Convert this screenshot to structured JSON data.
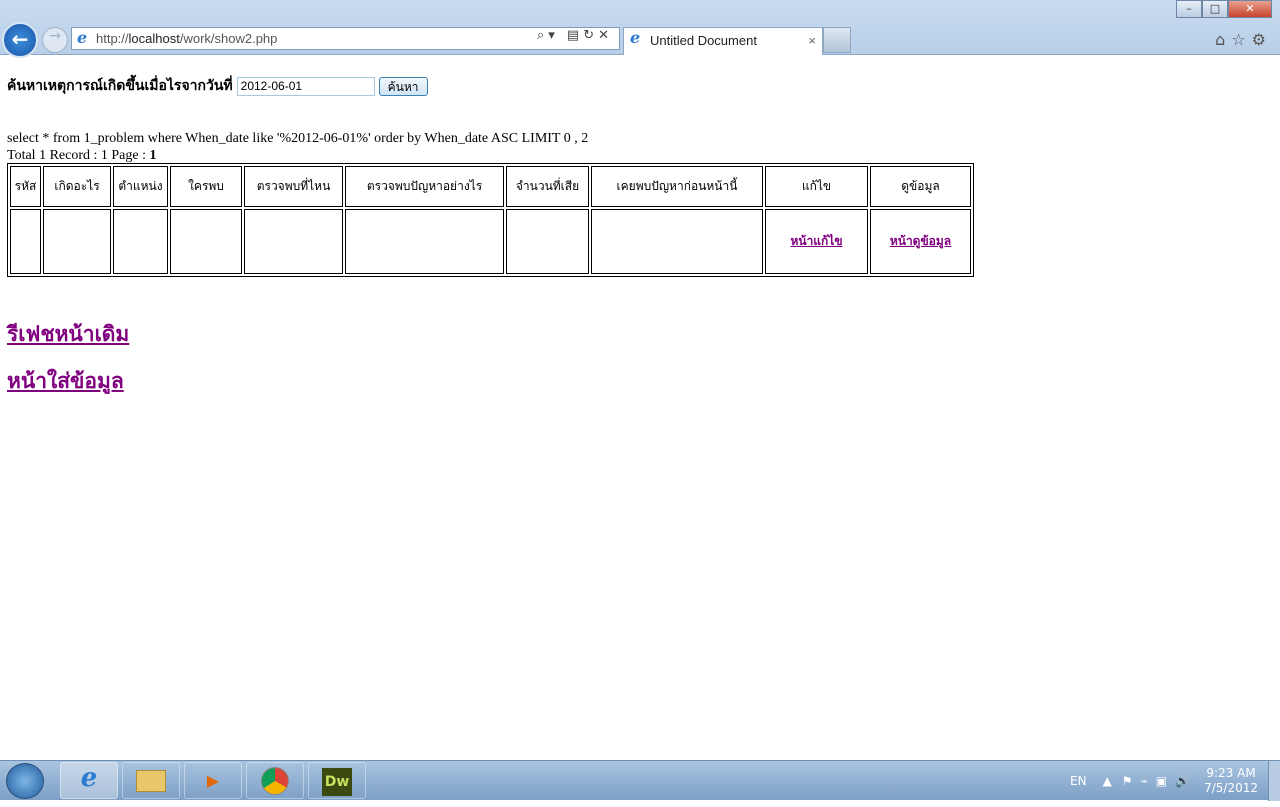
{
  "browser": {
    "url_host": "http://",
    "url_bold": "localhost",
    "url_path": "/work/show2.php",
    "tab_title": "Untitled Document",
    "close_tab": "×"
  },
  "search": {
    "label": "ค้นหาเหตุการณ์เกิดขึ้นเมื่อไรจากวันที่",
    "value": "2012-06-01",
    "button": "ค้นหา"
  },
  "sql": "select * from 1_problem where When_date like '%2012-06-01%' order by When_date ASC LIMIT 0 , 2",
  "summary": {
    "prefix": "Total 1 Record : 1 Page : ",
    "page": "1"
  },
  "table": {
    "headers": [
      "รหัส",
      "เกิดอะไร",
      "ตำแหน่ง",
      "ใครพบ",
      "ตรวจพบที่ไหน",
      "ตรวจพบปัญหาอย่างไร",
      "จำนวนที่เสีย",
      "เคยพบปัญหาก่อนหน้านี้",
      "แก้ไข",
      "ดูข้อมูล"
    ],
    "row": {
      "edit_link": "หน้าแก้ไข",
      "view_link": "หน้าดูข้อมูล"
    }
  },
  "links": {
    "refresh": "รีเฟชหน้าเดิม",
    "insert": "หน้าใส่ข้อมูล"
  },
  "taskbar": {
    "dw": "Dw",
    "lang": "EN",
    "time": "9:23 AM",
    "date": "7/5/2012"
  }
}
